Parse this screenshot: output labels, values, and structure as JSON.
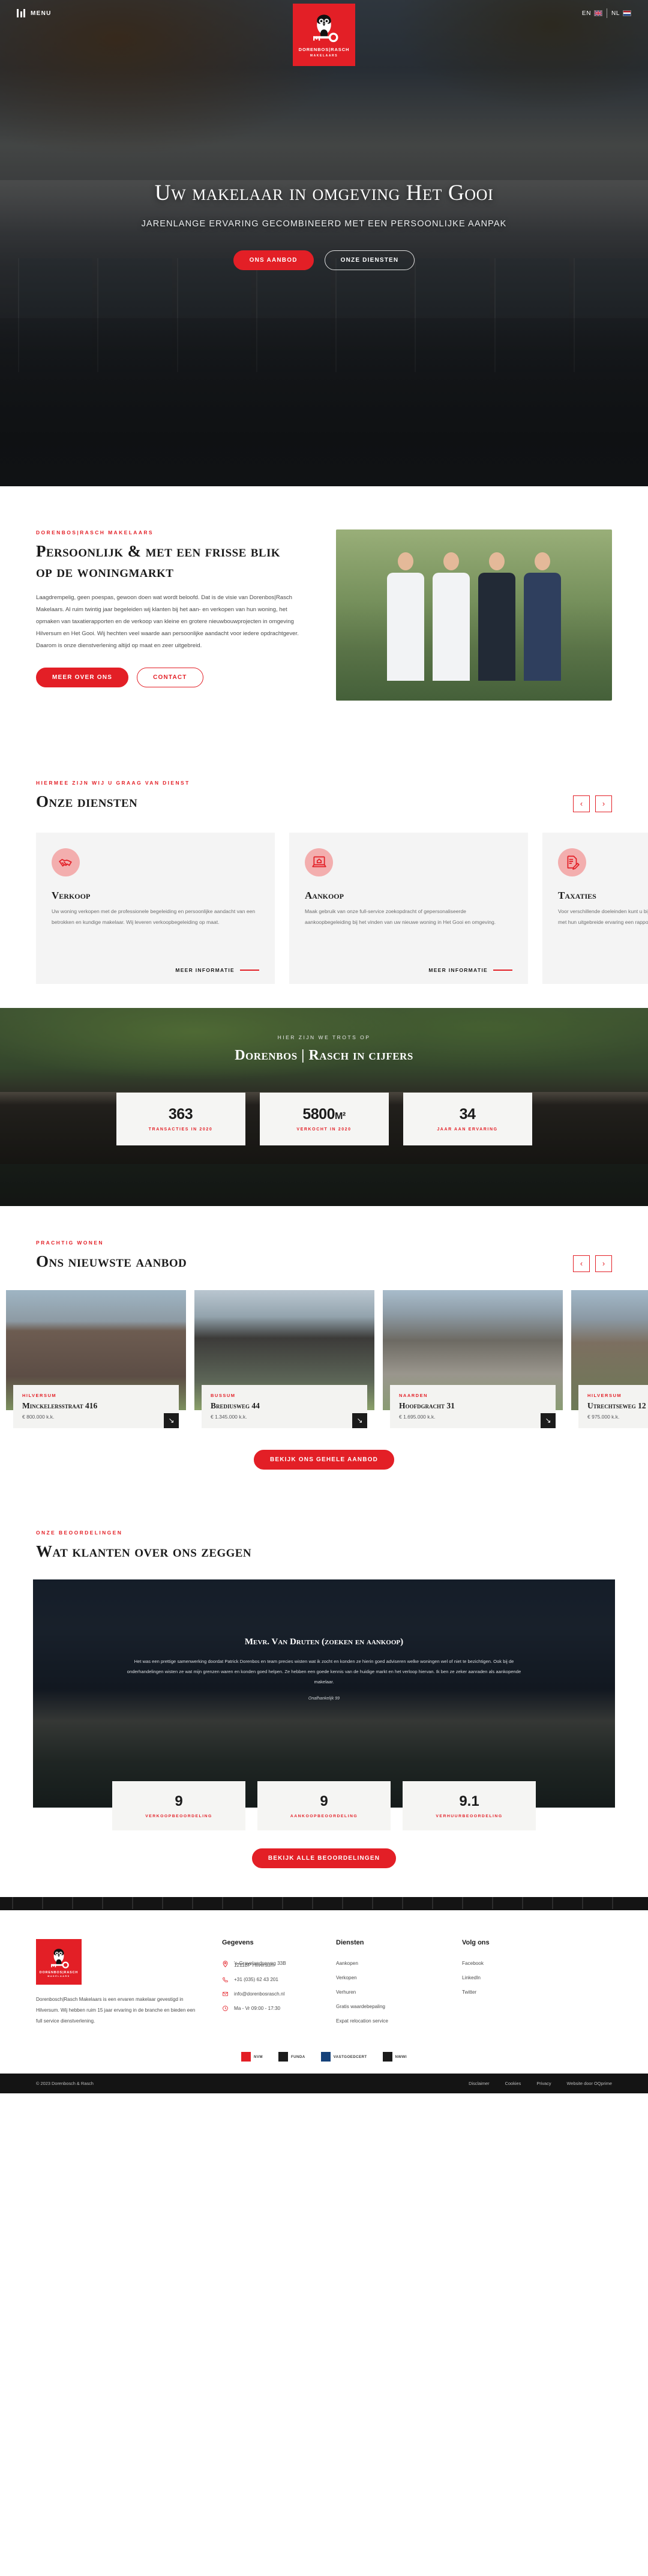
{
  "brand": {
    "name_line1": "DORENBOS|RASCH",
    "name_line2": "MAKELAARS",
    "accent": "#e31f26",
    "dark": "#141414"
  },
  "topbar": {
    "menu_label": "MENU",
    "lang_en": "EN",
    "lang_nl": "NL"
  },
  "hero": {
    "title": "Uw makelaar in omgeving Het Gooi",
    "subtitle": "JARENLANGE ERVARING GECOMBINEERD MET EEN PERSOONLIJKE AANPAK",
    "btn_primary": "ONS AANBOD",
    "btn_secondary": "ONZE DIENSTEN"
  },
  "about": {
    "eyebrow": "DORENBOS|RASCH MAKELAARS",
    "title": "Persoonlijk & met een frisse blik op de woningmarkt",
    "body": "Laagdrempelig, geen poespas, gewoon doen wat wordt beloofd. Dat is de visie van Dorenbos|Rasch Makelaars. Al ruim twintig jaar begeleiden wij klanten bij het aan- en verkopen van hun woning, het opmaken van taxatierapporten en de verkoop van kleine en grotere nieuwbouwprojecten in omgeving Hilversum en Het Gooi. Wij hechten veel waarde aan persoonlijke aandacht voor iedere opdrachtgever. Daarom is onze dienstverlening altijd op maat en zeer uitgebreid.",
    "btn_primary": "MEER OVER ONS",
    "btn_secondary": "CONTACT"
  },
  "services": {
    "eyebrow": "HIERMEE ZIJN WIJ U GRAAG VAN DIENST",
    "title": "Onze diensten",
    "prev": "‹",
    "next": "›",
    "more_label": "MEER INFORMATIE",
    "cards": [
      {
        "icon": "handshake-icon",
        "title": "Verkoop",
        "text": "Uw woning verkopen met de professionele begeleiding en persoonlijke aandacht van een betrokken en kundige makelaar. Wij leveren verkoopbegeleiding op maat."
      },
      {
        "icon": "laptop-house-icon",
        "title": "Aankoop",
        "text": "Maak gebruik van onze full-service zoekopdracht of gepersonaliseerde aankoopbegeleiding bij het vinden van uw nieuwe woning in Het Gooi en omgeving."
      },
      {
        "icon": "document-pen-icon",
        "title": "Taxaties",
        "text": "Voor verschillende doeleinden kunt u bij onze gecertificeerde taxateurs terecht. Zij stellen met hun uitgebreide ervaring een rapport op."
      }
    ]
  },
  "stats": {
    "eyebrow": "HIER ZIJN WE TROTS OP",
    "title": "Dorenbos | Rasch in cijfers",
    "items": [
      {
        "value": "363",
        "unit": "",
        "label": "TRANSACTIES IN 2020"
      },
      {
        "value": "5800",
        "unit": "M²",
        "label": "VERKOCHT IN 2020"
      },
      {
        "value": "34",
        "unit": "",
        "label": "JAAR AAN ERVARING"
      }
    ]
  },
  "listings": {
    "eyebrow": "PRACHTIG WONEN",
    "title": "Ons nieuwste aanbod",
    "prev": "‹",
    "next": "›",
    "cta": "BEKIJK ONS GEHELE AANBOD",
    "arrow": "↘",
    "items": [
      {
        "city": "HILVERSUM",
        "address": "Minckelersstraat 416",
        "price": "€ 800.000 k.k."
      },
      {
        "city": "BUSSUM",
        "address": "Brediusweg 44",
        "price": "€ 1.345.000 k.k."
      },
      {
        "city": "NAARDEN",
        "address": "Hoofdgracht 31",
        "price": "€ 1.695.000 k.k."
      },
      {
        "city": "HILVERSUM",
        "address": "Utrechtseweg 12",
        "price": "€ 975.000 k.k."
      }
    ]
  },
  "reviews": {
    "eyebrow": "ONZE BEOORDELINGEN",
    "title": "Wat klanten over ons zeggen",
    "name": "Mevr. Van Druten (zoeken en aankoop)",
    "text": "Het was een prettige samenwerking doordat Patrick Dorenbos en team precies wisten wat ik zocht en konden ze hierin goed adviseren welke woningen wel of niet te bezichtigen. Ook bij de onderhandelingen wisten ze wat mijn grenzen waren en konden goed helpen. Ze hebben een goede kennis van de huidige markt en het verloop hiervan. Ik ben ze zeker aanraden als aankopende makelaar.",
    "meta": "Onafhankelijk 99",
    "cta": "BEKIJK ALLE BEOORDELINGEN",
    "stats": [
      {
        "value": "9",
        "label": "VERKOOPBEOORDELING"
      },
      {
        "value": "9",
        "label": "AANKOOPBEOORDELING"
      },
      {
        "value": "9.1",
        "label": "VERHUURBEOORDELING"
      }
    ]
  },
  "footer": {
    "about": "Dorenbosch|Rasch Makelaars is een ervaren makelaar gevestigd in Hilversum. Wij hebben ruim 15 jaar ervaring in de branche en bieden een full service dienstverlening.",
    "col_data_title": "Gegevens",
    "address_line1": "'s-Gravelandseweg 33B",
    "address_line2": "1211BP Hilversum",
    "phone": "+31 (035) 62 43 201",
    "email": "info@dorenbosrasch.nl",
    "hours": "Ma - Vr 09:00 - 17:30",
    "col_services_title": "Diensten",
    "services_links": [
      "Aankopen",
      "Verkopen",
      "Verhuren",
      "Gratis waardebepaling",
      "Expat relocation service"
    ],
    "col_social_title": "Volg ons",
    "social_links": [
      "Facebook",
      "LinkedIn",
      "Twitter"
    ],
    "badges": [
      "NVM",
      "FUNDA",
      "VASTGOEDCERT",
      "NWWI"
    ],
    "copyright": "© 2023 Dorenbosch & Rasch",
    "bottom_links": [
      "Disclaimer",
      "Cookies",
      "Privacy",
      "Website door OQprime"
    ]
  }
}
